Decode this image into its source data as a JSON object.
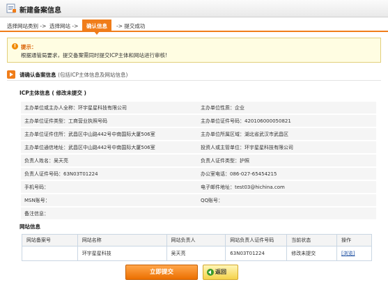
{
  "window": {
    "title": "新建备案信息"
  },
  "steps": [
    {
      "label": "选择网站类别 ->"
    },
    {
      "label": "选择网站 ->"
    },
    {
      "label": "确认信息"
    },
    {
      "label": "-> 提交成功"
    }
  ],
  "tip": {
    "title": "提示：",
    "text": "根据通管局要求，提交备案需同时提交ICP主体和网站进行审核!"
  },
  "section": {
    "title": "请确认备案信息",
    "subtitle": "(包括ICP主体信息及网站信息)"
  },
  "icp": {
    "title": "ICP主体信息 ( 修改未提交 )",
    "fields": [
      {
        "left": "主办单位或主办人全称：环宇星星科技有限公司",
        "right": "主办单位性质：企业"
      },
      {
        "left": "主办单位证件类型：工商营业执照号码",
        "right": "主办单位证件号码：420106000050821"
      },
      {
        "left": "主办单位证件住所：武昌区中山路442号中南国际大厦506室",
        "right": "主办单位所属区域：湖北省武汉市武昌区"
      },
      {
        "left": "主办单位通信地址：武昌区中山路442号中南国际大厦506室",
        "right": "投资人或主管单位：环宇星星科技有限公司"
      },
      {
        "left": "负责人姓名：吴天亮",
        "right": "负责人证件类型：护照"
      },
      {
        "left": "负责人证件号码：63N03T01224",
        "right": "办公室电话：086-027-65454215"
      },
      {
        "left": "手机号码：",
        "right": "电子邮件地址：test03@hichina.com"
      },
      {
        "left": "MSN账号：",
        "right": "QQ账号："
      },
      {
        "left": "备注信息：",
        "right": ""
      }
    ]
  },
  "sites": {
    "title": "网站信息",
    "columns": [
      "网站备案号",
      "网站名称",
      "网站负责人",
      "网站负责人证件号码",
      "当前状态",
      "操作"
    ],
    "rows": [
      {
        "record_no": "",
        "name": "环宇星星科技",
        "owner": "吴天亮",
        "owner_id": "63N03T01224",
        "status": "修改未提交",
        "action": "[浏览]"
      }
    ]
  },
  "buttons": {
    "submit": "立即提交",
    "back": "返回"
  },
  "colors": {
    "accent": "#f07d1a",
    "tip_bg": "#fffde2",
    "row_bg": "#f5f5f5",
    "link": "#1d4fa1"
  }
}
